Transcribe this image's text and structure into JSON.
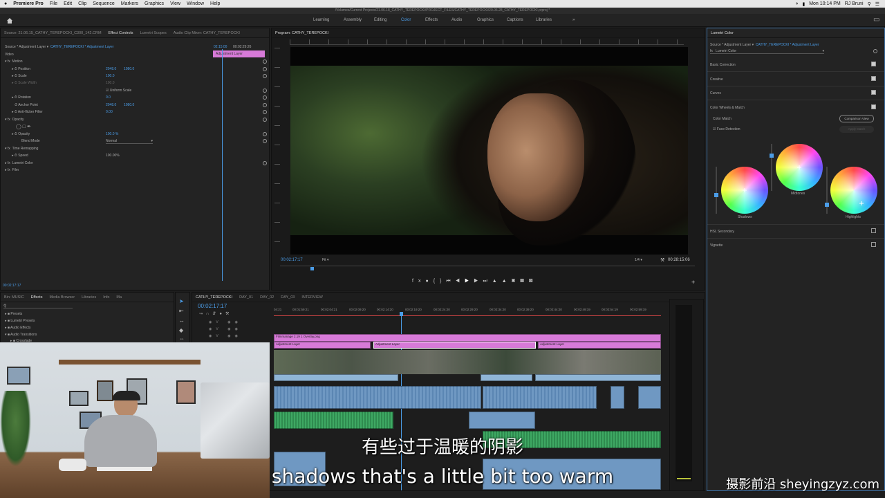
{
  "menubar": {
    "apple": "",
    "app": "Premiere Pro",
    "items": [
      "File",
      "Edit",
      "Clip",
      "Sequence",
      "Markers",
      "Graphics",
      "View",
      "Window",
      "Help"
    ],
    "clock": "Mon 10:14 PM",
    "user": "RJ Bruni"
  },
  "doc_path": "/Volumes/Current Projects/21.06.18_CATHY_TEREPOCKI/PROJECT_FILES/CATHY_TEREPOCKI/20.06.28_CATHY_TEREPOCKI.prproj *",
  "workspaces": [
    "Learning",
    "Assembly",
    "Editing",
    "Color",
    "Effects",
    "Audio",
    "Graphics",
    "Captions",
    "Libraries"
  ],
  "active_workspace": "Color",
  "effect_controls": {
    "tabs": [
      "Source: 21.06.15_CATHY_TEREPOCKI_C300_142.CRM",
      "Effect Controls",
      "Lumetri Scopes",
      "Audio Clip Mixer: CATHY_TEREPOCKI"
    ],
    "source_line": "Source * Adjustment Layer",
    "sequence_line": "CATHY_TEREPOCKI * Adjustment Layer",
    "tc_start": "02:15:00",
    "tc_end": "00:02:29:26",
    "clip_label": "Adjustment Layer",
    "section_video": "Video",
    "rows": [
      {
        "label": "Motion",
        "v1": "",
        "v2": ""
      },
      {
        "label": "Position",
        "v1": "2048.0",
        "v2": "1080.0"
      },
      {
        "label": "Scale",
        "v1": "100.0",
        "v2": ""
      },
      {
        "label": "Scale Width",
        "v1": "100.0",
        "v2": ""
      },
      {
        "label": "Uniform Scale",
        "v1": "",
        "v2": ""
      },
      {
        "label": "Rotation",
        "v1": "0.0",
        "v2": ""
      },
      {
        "label": "Anchor Point",
        "v1": "2048.0",
        "v2": "1080.0"
      },
      {
        "label": "Anti-flicker Filter",
        "v1": "0.00",
        "v2": ""
      },
      {
        "label": "Opacity",
        "v1": "",
        "v2": ""
      },
      {
        "label": "Opacity",
        "v1": "100.0 %",
        "v2": ""
      },
      {
        "label": "Blend Mode",
        "v1": "Normal",
        "v2": ""
      },
      {
        "label": "Time Remapping",
        "v1": "",
        "v2": ""
      },
      {
        "label": "Speed",
        "v1": "100.00%",
        "v2": ""
      },
      {
        "label": "Lumetri Color",
        "v1": "",
        "v2": ""
      },
      {
        "label": "Film",
        "v1": "",
        "v2": ""
      }
    ],
    "timecode": "00:02:17:17"
  },
  "program": {
    "title": "Program: CATHY_TEREPOCKI",
    "timecode": "00:02:17:17",
    "fit": "Fit",
    "resolution": "1/4",
    "duration": "00:28:15:06"
  },
  "lumetri": {
    "title": "Lumetri Color",
    "source_line": "Source * Adjustment Layer",
    "sequence_line": "CATHY_TEREPOCKI * Adjustment Layer",
    "fx_name": "Lumetri Color",
    "sections": [
      "Basic Correction",
      "Creative",
      "Curves",
      "Color Wheels & Match"
    ],
    "color_match": "Color Match",
    "comparison_view": "Comparison View",
    "face_detection": "Face Detection",
    "apply_match": "Apply Match",
    "wheels": [
      "Shadows",
      "Midtones",
      "Highlights"
    ],
    "hsl": "HSL Secondary",
    "vignette": "Vignette"
  },
  "project": {
    "tabs": [
      "Bin: MUSIC",
      "Effects",
      "Media Browser",
      "Libraries",
      "Info",
      "Ma"
    ],
    "items": [
      "Presets",
      "Lumetri Presets",
      "Audio Effects",
      "Audio Transitions",
      "Crossfade"
    ]
  },
  "timeline": {
    "tabs": [
      "CATHY_TEREPOCKI",
      "DAY_01",
      "DAY_02",
      "DAY_03",
      "INTERVIEW"
    ],
    "timecode": "00:02:17:17",
    "ruler": [
      "04:21",
      "00:01:59:21",
      "00:02:04:21",
      "00:02:09:20",
      "00:02:14:20",
      "00:02:19:20",
      "00:02:24:20",
      "00:02:29:20",
      "00:02:34:20",
      "00:02:39:20",
      "00:02:44:20",
      "00:02:49:19",
      "00:02:54:19",
      "00:02:59:19"
    ],
    "top_clip": "Filmmanage 2.19 1 Overlay.png",
    "adjustment": "Adjustment Layer"
  },
  "subtitle": {
    "zh": "有些过于温暖的阴影",
    "en": "shadows that's a little bit too warm"
  },
  "watermark": "摄影前沿 sheyingzyz.com",
  "colors": {
    "accent": "#4b9de8",
    "panel": "#232323",
    "adjust_clip": "#d77ad8",
    "audio": "#3ea863"
  }
}
